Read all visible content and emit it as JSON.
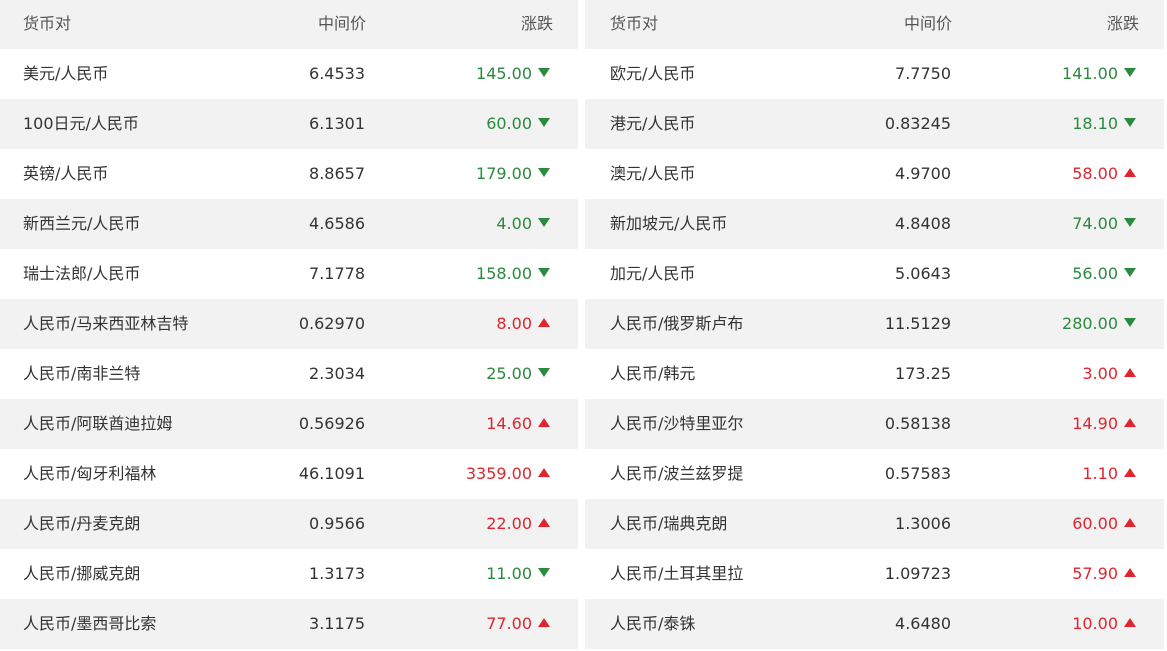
{
  "colors": {
    "down": "#2a8a3e",
    "up": "#e0252f",
    "stripe": "#f2f2f2"
  },
  "headers": {
    "pair": "货币对",
    "mid": "中间价",
    "change": "涨跌"
  },
  "left_rows": [
    {
      "pair": "美元/人民币",
      "mid": "6.4533",
      "change": "145.00",
      "dir": "down"
    },
    {
      "pair": "100日元/人民币",
      "mid": "6.1301",
      "change": "60.00",
      "dir": "down"
    },
    {
      "pair": "英镑/人民币",
      "mid": "8.8657",
      "change": "179.00",
      "dir": "down"
    },
    {
      "pair": "新西兰元/人民币",
      "mid": "4.6586",
      "change": "4.00",
      "dir": "down"
    },
    {
      "pair": "瑞士法郎/人民币",
      "mid": "7.1778",
      "change": "158.00",
      "dir": "down"
    },
    {
      "pair": "人民币/马来西亚林吉特",
      "mid": "0.62970",
      "change": "8.00",
      "dir": "up"
    },
    {
      "pair": "人民币/南非兰特",
      "mid": "2.3034",
      "change": "25.00",
      "dir": "down"
    },
    {
      "pair": "人民币/阿联酋迪拉姆",
      "mid": "0.56926",
      "change": "14.60",
      "dir": "up"
    },
    {
      "pair": "人民币/匈牙利福林",
      "mid": "46.1091",
      "change": "3359.00",
      "dir": "up"
    },
    {
      "pair": "人民币/丹麦克朗",
      "mid": "0.9566",
      "change": "22.00",
      "dir": "up"
    },
    {
      "pair": "人民币/挪威克朗",
      "mid": "1.3173",
      "change": "11.00",
      "dir": "down"
    },
    {
      "pair": "人民币/墨西哥比索",
      "mid": "3.1175",
      "change": "77.00",
      "dir": "up"
    }
  ],
  "right_rows": [
    {
      "pair": "欧元/人民币",
      "mid": "7.7750",
      "change": "141.00",
      "dir": "down"
    },
    {
      "pair": "港元/人民币",
      "mid": "0.83245",
      "change": "18.10",
      "dir": "down"
    },
    {
      "pair": "澳元/人民币",
      "mid": "4.9700",
      "change": "58.00",
      "dir": "up"
    },
    {
      "pair": "新加坡元/人民币",
      "mid": "4.8408",
      "change": "74.00",
      "dir": "down"
    },
    {
      "pair": "加元/人民币",
      "mid": "5.0643",
      "change": "56.00",
      "dir": "down"
    },
    {
      "pair": "人民币/俄罗斯卢布",
      "mid": "11.5129",
      "change": "280.00",
      "dir": "down"
    },
    {
      "pair": "人民币/韩元",
      "mid": "173.25",
      "change": "3.00",
      "dir": "up"
    },
    {
      "pair": "人民币/沙特里亚尔",
      "mid": "0.58138",
      "change": "14.90",
      "dir": "up"
    },
    {
      "pair": "人民币/波兰兹罗提",
      "mid": "0.57583",
      "change": "1.10",
      "dir": "up"
    },
    {
      "pair": "人民币/瑞典克朗",
      "mid": "1.3006",
      "change": "60.00",
      "dir": "up"
    },
    {
      "pair": "人民币/土耳其里拉",
      "mid": "1.09723",
      "change": "57.90",
      "dir": "up"
    },
    {
      "pair": "人民币/泰铢",
      "mid": "4.6480",
      "change": "10.00",
      "dir": "up"
    }
  ]
}
